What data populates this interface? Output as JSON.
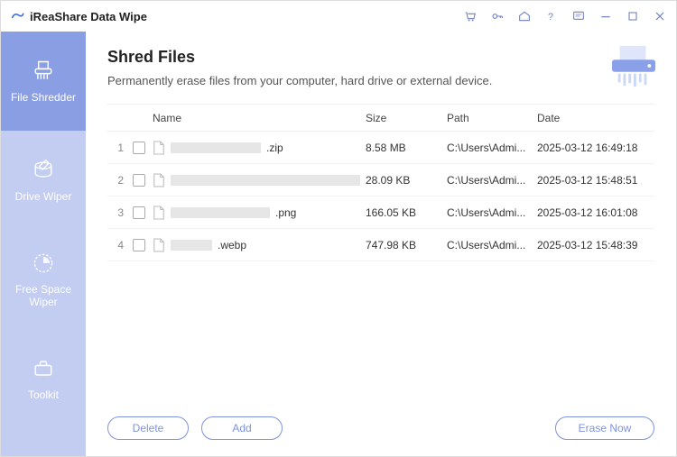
{
  "app": {
    "title": "iReaShare Data Wipe"
  },
  "sidebar": {
    "items": [
      {
        "label": "File Shredder"
      },
      {
        "label": "Drive Wiper"
      },
      {
        "label": "Free Space Wiper"
      },
      {
        "label": "Toolkit"
      }
    ]
  },
  "page": {
    "heading": "Shred Files",
    "subtitle": "Permanently erase files from your computer, hard drive or external device."
  },
  "table": {
    "headers": {
      "name": "Name",
      "size": "Size",
      "path": "Path",
      "date": "Date"
    },
    "rows": [
      {
        "idx": "1",
        "name_suffix": ".zip",
        "redact_w": 100,
        "size": "8.58 MB",
        "path": "C:\\Users\\Admi...",
        "date": "2025-03-12 16:49:18"
      },
      {
        "idx": "2",
        "name_suffix": "",
        "redact_w": 210,
        "size": "28.09 KB",
        "path": "C:\\Users\\Admi...",
        "date": "2025-03-12 15:48:51"
      },
      {
        "idx": "3",
        "name_suffix": ".png",
        "redact_w": 110,
        "size": "166.05 KB",
        "path": "C:\\Users\\Admi...",
        "date": "2025-03-12 16:01:08"
      },
      {
        "idx": "4",
        "name_suffix": ".webp",
        "redact_w": 46,
        "size": "747.98 KB",
        "path": "C:\\Users\\Admi...",
        "date": "2025-03-12 15:48:39"
      }
    ]
  },
  "buttons": {
    "delete": "Delete",
    "add": "Add",
    "erase_now": "Erase Now"
  }
}
